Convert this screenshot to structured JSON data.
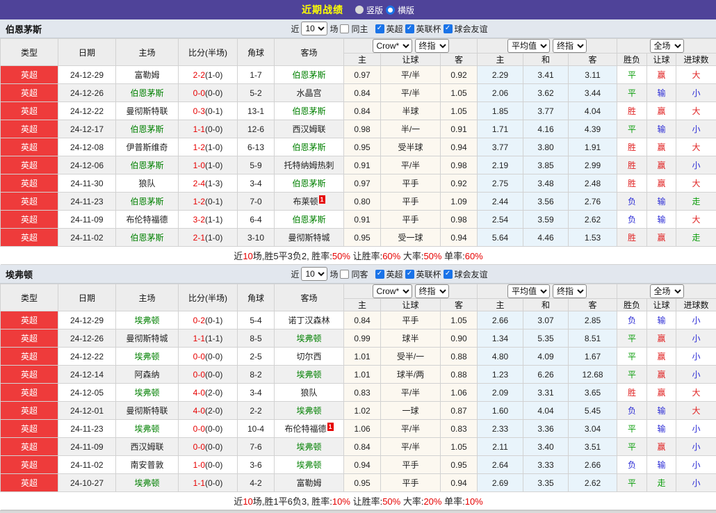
{
  "topbar": {
    "title": "近期战绩",
    "vertical_label": "竖版",
    "horizontal_label": "横版"
  },
  "table_header": {
    "cols": [
      "类型",
      "日期",
      "主场",
      "比分(半场)",
      "角球",
      "客场"
    ],
    "sub_cols": [
      "主",
      "让球",
      "客",
      "主",
      "和",
      "客",
      "胜负",
      "让球",
      "进球数"
    ],
    "bookmaker_dd": "Crow*",
    "final_dd": "终指",
    "avg_dd": "平均值",
    "full_dd": "全场"
  },
  "color_map": {
    "胜": "red",
    "平": "green",
    "负": "blue",
    "赢": "red",
    "输": "blue",
    "走": "green",
    "大": "red",
    "小": "blue"
  },
  "sections": [
    {
      "team": "伯恩茅斯",
      "controls": {
        "near_label": "近",
        "count": "10",
        "games_label": "场",
        "same_label": "同主",
        "leagues": [
          "英超",
          "英联杯",
          "球会友谊"
        ]
      },
      "rows": [
        {
          "type": "英超",
          "date": "24-12-29",
          "home": "富勒姆",
          "hg": false,
          "score": "2-2",
          "half": "(1-0)",
          "corner": "1-7",
          "away": "伯恩茅斯",
          "ag": true,
          "badge": "",
          "o1": "0.97",
          "hc": "平/半",
          "o2": "0.92",
          "a1": "2.29",
          "a2": "3.41",
          "a3": "3.11",
          "r1": "平",
          "r2": "赢",
          "r3": "大"
        },
        {
          "type": "英超",
          "date": "24-12-26",
          "home": "伯恩茅斯",
          "hg": true,
          "score": "0-0",
          "half": "(0-0)",
          "corner": "5-2",
          "away": "水晶宫",
          "ag": false,
          "badge": "",
          "o1": "0.84",
          "hc": "平/半",
          "o2": "1.05",
          "a1": "2.06",
          "a2": "3.62",
          "a3": "3.44",
          "r1": "平",
          "r2": "输",
          "r3": "小"
        },
        {
          "type": "英超",
          "date": "24-12-22",
          "home": "曼彻斯特联",
          "hg": false,
          "score": "0-3",
          "half": "(0-1)",
          "corner": "13-1",
          "away": "伯恩茅斯",
          "ag": true,
          "badge": "",
          "o1": "0.84",
          "hc": "半球",
          "o2": "1.05",
          "a1": "1.85",
          "a2": "3.77",
          "a3": "4.04",
          "r1": "胜",
          "r2": "赢",
          "r3": "大"
        },
        {
          "type": "英超",
          "date": "24-12-17",
          "home": "伯恩茅斯",
          "hg": true,
          "score": "1-1",
          "half": "(0-0)",
          "corner": "12-6",
          "away": "西汉姆联",
          "ag": false,
          "badge": "",
          "o1": "0.98",
          "hc": "半/一",
          "o2": "0.91",
          "a1": "1.71",
          "a2": "4.16",
          "a3": "4.39",
          "r1": "平",
          "r2": "输",
          "r3": "小"
        },
        {
          "type": "英超",
          "date": "24-12-08",
          "home": "伊普斯维奇",
          "hg": false,
          "score": "1-2",
          "half": "(1-0)",
          "corner": "6-13",
          "away": "伯恩茅斯",
          "ag": true,
          "badge": "",
          "o1": "0.95",
          "hc": "受半球",
          "o2": "0.94",
          "a1": "3.77",
          "a2": "3.80",
          "a3": "1.91",
          "r1": "胜",
          "r2": "赢",
          "r3": "大"
        },
        {
          "type": "英超",
          "date": "24-12-06",
          "home": "伯恩茅斯",
          "hg": true,
          "score": "1-0",
          "half": "(1-0)",
          "corner": "5-9",
          "away": "托特纳姆热刺",
          "ag": false,
          "badge": "",
          "o1": "0.91",
          "hc": "平/半",
          "o2": "0.98",
          "a1": "2.19",
          "a2": "3.85",
          "a3": "2.99",
          "r1": "胜",
          "r2": "赢",
          "r3": "小"
        },
        {
          "type": "英超",
          "date": "24-11-30",
          "home": "狼队",
          "hg": false,
          "score": "2-4",
          "half": "(1-3)",
          "corner": "3-4",
          "away": "伯恩茅斯",
          "ag": true,
          "badge": "",
          "o1": "0.97",
          "hc": "平手",
          "o2": "0.92",
          "a1": "2.75",
          "a2": "3.48",
          "a3": "2.48",
          "r1": "胜",
          "r2": "赢",
          "r3": "大"
        },
        {
          "type": "英超",
          "date": "24-11-23",
          "home": "伯恩茅斯",
          "hg": true,
          "score": "1-2",
          "half": "(0-1)",
          "corner": "7-0",
          "away": "布莱顿",
          "ag": false,
          "badge": "1",
          "o1": "0.80",
          "hc": "平手",
          "o2": "1.09",
          "a1": "2.44",
          "a2": "3.56",
          "a3": "2.76",
          "r1": "负",
          "r2": "输",
          "r3": "走"
        },
        {
          "type": "英超",
          "date": "24-11-09",
          "home": "布伦特福德",
          "hg": false,
          "score": "3-2",
          "half": "(1-1)",
          "corner": "6-4",
          "away": "伯恩茅斯",
          "ag": true,
          "badge": "",
          "o1": "0.91",
          "hc": "平手",
          "o2": "0.98",
          "a1": "2.54",
          "a2": "3.59",
          "a3": "2.62",
          "r1": "负",
          "r2": "输",
          "r3": "大"
        },
        {
          "type": "英超",
          "date": "24-11-02",
          "home": "伯恩茅斯",
          "hg": true,
          "score": "2-1",
          "half": "(1-0)",
          "corner": "3-10",
          "away": "曼彻斯特城",
          "ag": false,
          "badge": "",
          "o1": "0.95",
          "hc": "受一球",
          "o2": "0.94",
          "a1": "5.64",
          "a2": "4.46",
          "a3": "1.53",
          "r1": "胜",
          "r2": "赢",
          "r3": "走"
        }
      ],
      "summary_segments": [
        {
          "t": "近",
          "c": "k"
        },
        {
          "t": "10",
          "c": "r"
        },
        {
          "t": "场,胜5平3负2, 胜率:",
          "c": "k"
        },
        {
          "t": "50%",
          "c": "r"
        },
        {
          "t": " 让胜率:",
          "c": "k"
        },
        {
          "t": "60%",
          "c": "r"
        },
        {
          "t": " 大率:",
          "c": "k"
        },
        {
          "t": "50%",
          "c": "r"
        },
        {
          "t": " 单率:",
          "c": "k"
        },
        {
          "t": "60%",
          "c": "r"
        }
      ]
    },
    {
      "team": "埃弗顿",
      "controls": {
        "near_label": "近",
        "count": "10",
        "games_label": "场",
        "same_label": "同客",
        "leagues": [
          "英超",
          "英联杯",
          "球会友谊"
        ]
      },
      "rows": [
        {
          "type": "英超",
          "date": "24-12-29",
          "home": "埃弗顿",
          "hg": true,
          "score": "0-2",
          "half": "(0-1)",
          "corner": "5-4",
          "away": "诺丁汉森林",
          "ag": false,
          "badge": "",
          "o1": "0.84",
          "hc": "平手",
          "o2": "1.05",
          "a1": "2.66",
          "a2": "3.07",
          "a3": "2.85",
          "r1": "负",
          "r2": "输",
          "r3": "小"
        },
        {
          "type": "英超",
          "date": "24-12-26",
          "home": "曼彻斯特城",
          "hg": false,
          "score": "1-1",
          "half": "(1-1)",
          "corner": "8-5",
          "away": "埃弗顿",
          "ag": true,
          "badge": "",
          "o1": "0.99",
          "hc": "球半",
          "o2": "0.90",
          "a1": "1.34",
          "a2": "5.35",
          "a3": "8.51",
          "r1": "平",
          "r2": "赢",
          "r3": "小"
        },
        {
          "type": "英超",
          "date": "24-12-22",
          "home": "埃弗顿",
          "hg": true,
          "score": "0-0",
          "half": "(0-0)",
          "corner": "2-5",
          "away": "切尔西",
          "ag": false,
          "badge": "",
          "o1": "1.01",
          "hc": "受半/一",
          "o2": "0.88",
          "a1": "4.80",
          "a2": "4.09",
          "a3": "1.67",
          "r1": "平",
          "r2": "赢",
          "r3": "小"
        },
        {
          "type": "英超",
          "date": "24-12-14",
          "home": "阿森纳",
          "hg": false,
          "score": "0-0",
          "half": "(0-0)",
          "corner": "8-2",
          "away": "埃弗顿",
          "ag": true,
          "badge": "",
          "o1": "1.01",
          "hc": "球半/两",
          "o2": "0.88",
          "a1": "1.23",
          "a2": "6.26",
          "a3": "12.68",
          "r1": "平",
          "r2": "赢",
          "r3": "小"
        },
        {
          "type": "英超",
          "date": "24-12-05",
          "home": "埃弗顿",
          "hg": true,
          "score": "4-0",
          "half": "(2-0)",
          "corner": "3-4",
          "away": "狼队",
          "ag": false,
          "badge": "",
          "o1": "0.83",
          "hc": "平/半",
          "o2": "1.06",
          "a1": "2.09",
          "a2": "3.31",
          "a3": "3.65",
          "r1": "胜",
          "r2": "赢",
          "r3": "大"
        },
        {
          "type": "英超",
          "date": "24-12-01",
          "home": "曼彻斯特联",
          "hg": false,
          "score": "4-0",
          "half": "(2-0)",
          "corner": "2-2",
          "away": "埃弗顿",
          "ag": true,
          "badge": "",
          "o1": "1.02",
          "hc": "一球",
          "o2": "0.87",
          "a1": "1.60",
          "a2": "4.04",
          "a3": "5.45",
          "r1": "负",
          "r2": "输",
          "r3": "大"
        },
        {
          "type": "英超",
          "date": "24-11-23",
          "home": "埃弗顿",
          "hg": true,
          "score": "0-0",
          "half": "(0-0)",
          "corner": "10-4",
          "away": "布伦特福德",
          "ag": false,
          "badge": "1",
          "o1": "1.06",
          "hc": "平/半",
          "o2": "0.83",
          "a1": "2.33",
          "a2": "3.36",
          "a3": "3.04",
          "r1": "平",
          "r2": "输",
          "r3": "小"
        },
        {
          "type": "英超",
          "date": "24-11-09",
          "home": "西汉姆联",
          "hg": false,
          "score": "0-0",
          "half": "(0-0)",
          "corner": "7-6",
          "away": "埃弗顿",
          "ag": true,
          "badge": "",
          "o1": "0.84",
          "hc": "平/半",
          "o2": "1.05",
          "a1": "2.11",
          "a2": "3.40",
          "a3": "3.51",
          "r1": "平",
          "r2": "赢",
          "r3": "小"
        },
        {
          "type": "英超",
          "date": "24-11-02",
          "home": "南安普敦",
          "hg": false,
          "score": "1-0",
          "half": "(0-0)",
          "corner": "3-6",
          "away": "埃弗顿",
          "ag": true,
          "badge": "",
          "o1": "0.94",
          "hc": "平手",
          "o2": "0.95",
          "a1": "2.64",
          "a2": "3.33",
          "a3": "2.66",
          "r1": "负",
          "r2": "输",
          "r3": "小"
        },
        {
          "type": "英超",
          "date": "24-10-27",
          "home": "埃弗顿",
          "hg": true,
          "score": "1-1",
          "half": "(0-0)",
          "corner": "4-2",
          "away": "富勒姆",
          "ag": false,
          "badge": "",
          "o1": "0.95",
          "hc": "平手",
          "o2": "0.94",
          "a1": "2.69",
          "a2": "3.35",
          "a3": "2.62",
          "r1": "平",
          "r2": "走",
          "r3": "小"
        }
      ],
      "summary_segments": [
        {
          "t": "近",
          "c": "k"
        },
        {
          "t": "10",
          "c": "r"
        },
        {
          "t": "场,胜1平6负3, 胜率:",
          "c": "k"
        },
        {
          "t": "10%",
          "c": "r"
        },
        {
          "t": " 让胜率:",
          "c": "k"
        },
        {
          "t": "50%",
          "c": "r"
        },
        {
          "t": " 大率:",
          "c": "k"
        },
        {
          "t": "20%",
          "c": "r"
        },
        {
          "t": " 单率:",
          "c": "k"
        },
        {
          "t": "10%",
          "c": "r"
        }
      ]
    }
  ]
}
